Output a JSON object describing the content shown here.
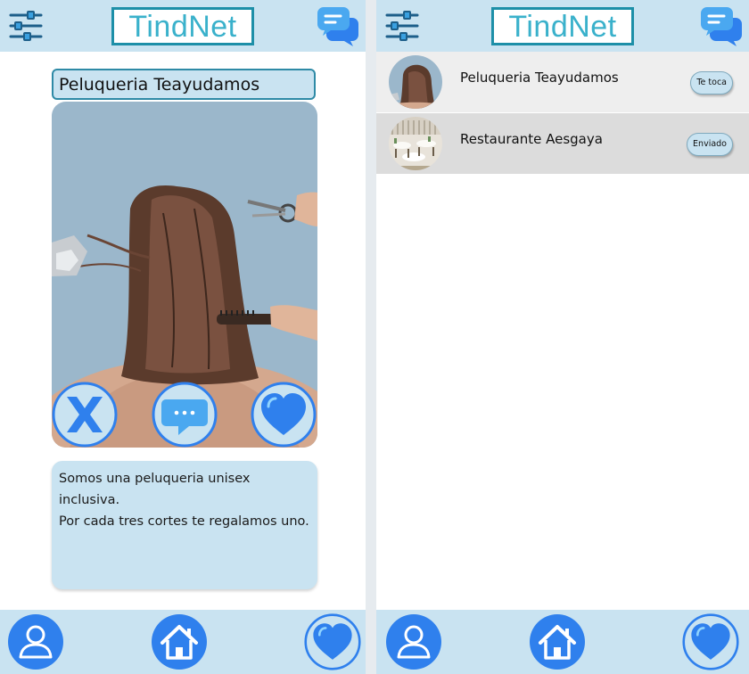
{
  "app": {
    "logo_text": "TindNet",
    "colors": {
      "bar_background": "#c9e3f1",
      "logo_text": "#3ab1cb",
      "logo_border": "#1d8fa8",
      "icon_blue": "#2f80ed",
      "icon_light_blue": "#8fd3ff"
    }
  },
  "left_screen": {
    "topbar": {
      "left_icon": "filter-sliders-icon",
      "right_icon": "chat-bubbles-icon"
    },
    "profile": {
      "name": "Peluqueria Teayudamos",
      "photo": "hair-salon-photo",
      "description_lines": [
        "Somos una peluqueria unisex inclusiva.",
        "Por cada tres cortes te regalamos uno."
      ]
    },
    "actions": [
      {
        "id": "reject",
        "icon": "x-reject-icon"
      },
      {
        "id": "message",
        "icon": "message-bubble-icon"
      },
      {
        "id": "like",
        "icon": "heart-icon"
      }
    ],
    "bottom_nav": [
      "user-profile-icon",
      "home-icon",
      "heart-icon"
    ]
  },
  "right_screen": {
    "topbar": {
      "left_icon": "filter-sliders-icon",
      "right_icon": "chat-bubbles-icon"
    },
    "matches": [
      {
        "name": "Peluqueria Teayudamos",
        "badge": "Te toca",
        "avatar": "hair-salon-avatar"
      },
      {
        "name": "Restaurante Aesgaya",
        "badge": "Enviado",
        "avatar": "restaurant-avatar"
      }
    ],
    "bottom_nav": [
      "user-profile-icon",
      "home-icon",
      "heart-icon"
    ]
  }
}
